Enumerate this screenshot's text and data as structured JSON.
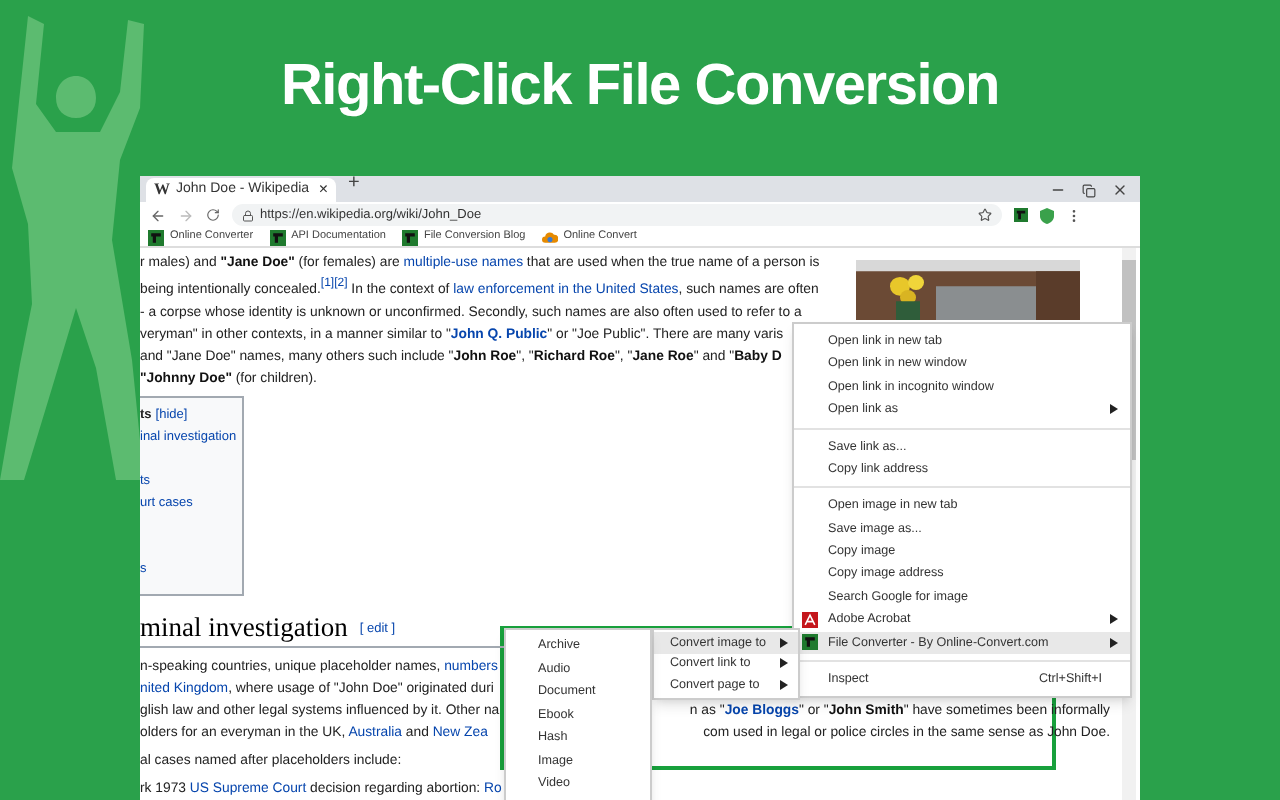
{
  "banner": {
    "title": "Right-Click File Conversion"
  },
  "browser": {
    "tab": {
      "favicon": "W",
      "title": "John Doe - Wikipedia",
      "close": "×",
      "new_tab": "+"
    },
    "url": "https://en.wikipedia.org/wiki/John_Doe",
    "bookmarks": [
      {
        "label": "Online Converter",
        "kind": "converter"
      },
      {
        "label": "API Documentation",
        "kind": "converter"
      },
      {
        "label": "File Conversion Blog",
        "kind": "converter"
      },
      {
        "label": "Online Convert",
        "kind": "cloud"
      }
    ]
  },
  "article": {
    "intro_lines": [
      [
        {
          "kind": "plain",
          "text": "r males) and "
        },
        {
          "kind": "bold",
          "text": "\"Jane Doe\""
        },
        {
          "kind": "plain",
          "text": " (for females) are "
        },
        {
          "kind": "link",
          "text": "multiple-use names"
        },
        {
          "kind": "plain",
          "text": " that are used when the true name of a person is"
        }
      ],
      [
        {
          "kind": "plain",
          "text": "being intentionally concealed."
        },
        {
          "kind": "sup",
          "text": "[1][2]"
        },
        {
          "kind": "plain",
          "text": " In the context of "
        },
        {
          "kind": "link",
          "text": "law enforcement in the United States"
        },
        {
          "kind": "plain",
          "text": ", such names are often"
        }
      ],
      [
        {
          "kind": "plain",
          "text": "- a corpse whose identity is unknown or unconfirmed. Secondly, such names are also often used to refer to a"
        }
      ],
      [
        {
          "kind": "plain",
          "text": "veryman\" in other contexts, in a manner similar to \""
        },
        {
          "kind": "boldlink",
          "text": "John Q. Public"
        },
        {
          "kind": "plain",
          "text": "\" or \"Joe Public\". There are many varis"
        }
      ],
      [
        {
          "kind": "plain",
          "text": " and \"Jane Doe\" names, many others such include \""
        },
        {
          "kind": "bold",
          "text": "John Roe"
        },
        {
          "kind": "plain",
          "text": "\", \""
        },
        {
          "kind": "bold",
          "text": "Richard Roe"
        },
        {
          "kind": "plain",
          "text": "\", \""
        },
        {
          "kind": "bold",
          "text": "Jane Roe"
        },
        {
          "kind": "plain",
          "text": "\" and \""
        },
        {
          "kind": "bold",
          "text": "Baby D"
        }
      ],
      [
        {
          "kind": "bold",
          "text": "\"Johnny Doe\""
        },
        {
          "kind": "plain",
          "text": " (for children)."
        }
      ]
    ],
    "toc": [
      {
        "kind": "head",
        "text": "ts",
        "link": "[hide]"
      },
      {
        "kind": "item",
        "text": "inal investigation"
      },
      {
        "kind": "gap"
      },
      {
        "kind": "item",
        "text": "ts"
      },
      {
        "kind": "item",
        "text": "urt cases"
      },
      {
        "kind": "gap"
      },
      {
        "kind": "gap"
      },
      {
        "kind": "item",
        "text": "s"
      }
    ],
    "heading": "minal investigation",
    "edit": "[ edit ]",
    "body_lines": [
      {
        "left": [
          {
            "kind": "plain",
            "text": "n-speaking countries, unique placeholder names, "
          },
          {
            "kind": "link",
            "text": "numbers"
          }
        ]
      },
      {
        "left": [
          {
            "kind": "link",
            "text": "nited Kingdom"
          },
          {
            "kind": "plain",
            "text": ", where usage of \"John Doe\" originated duri"
          }
        ]
      },
      {
        "left": [
          {
            "kind": "plain",
            "text": "glish law and other legal systems influenced by it. Other na"
          }
        ],
        "right": [
          {
            "kind": "plain",
            "text": "n as \""
          },
          {
            "kind": "boldlink",
            "text": "Joe Bloggs"
          },
          {
            "kind": "plain",
            "text": "\" or \""
          },
          {
            "kind": "bold",
            "text": "John Smith"
          },
          {
            "kind": "plain",
            "text": "\" have sometimes been informally"
          }
        ]
      },
      {
        "left": [
          {
            "kind": "plain",
            "text": "olders for an everyman in the UK, "
          },
          {
            "kind": "link",
            "text": "Australia"
          },
          {
            "kind": "plain",
            "text": " and "
          },
          {
            "kind": "link",
            "text": "New Zea"
          }
        ],
        "right": [
          {
            "kind": "plain",
            "text": "com used in legal or police circles in the same sense as John Doe."
          }
        ]
      },
      {
        "left": [
          {
            "kind": "plain",
            "text": "al cases named after placeholders include:"
          }
        ]
      },
      {
        "left": [
          {
            "kind": "plain",
            "text": "rk 1973 "
          },
          {
            "kind": "link",
            "text": "US Supreme Court"
          },
          {
            "kind": "plain",
            "text": " decision regarding abortion: "
          },
          {
            "kind": "link",
            "text": "Ro"
          }
        ]
      }
    ]
  },
  "context_menu": {
    "items": [
      {
        "kind": "item",
        "label": "Open link in new tab",
        "submenu": false,
        "selected": false
      },
      {
        "kind": "item",
        "label": "Open link in new window",
        "submenu": false,
        "selected": false
      },
      {
        "kind": "item",
        "label": "Open link in incognito window",
        "submenu": false,
        "selected": false
      },
      {
        "kind": "item",
        "label": "Open link as",
        "submenu": true,
        "selected": false
      },
      {
        "kind": "separator"
      },
      {
        "kind": "item",
        "label": "Save link as...",
        "submenu": false,
        "selected": false
      },
      {
        "kind": "item",
        "label": "Copy link address",
        "submenu": false,
        "selected": false
      },
      {
        "kind": "separator"
      },
      {
        "kind": "item",
        "label": "Open image in new tab",
        "submenu": false,
        "selected": false
      },
      {
        "kind": "item",
        "label": "Save image as...",
        "submenu": false,
        "selected": false
      },
      {
        "kind": "item",
        "label": "Copy image",
        "submenu": false,
        "selected": false
      },
      {
        "kind": "item",
        "label": "Copy image address",
        "submenu": false,
        "selected": false
      },
      {
        "kind": "item",
        "label": "Search Google for image",
        "submenu": false,
        "selected": false
      },
      {
        "kind": "acrobat",
        "label": "Adobe Acrobat",
        "submenu": true,
        "selected": false
      },
      {
        "kind": "converter",
        "label": "File Converter - By Online-Convert.com",
        "submenu": true,
        "selected": true
      },
      {
        "kind": "separator"
      },
      {
        "kind": "item",
        "label": "Inspect",
        "shortcut": "Ctrl+Shift+I",
        "submenu": false,
        "selected": false
      }
    ]
  },
  "convert_menu": {
    "items": [
      {
        "label": "Convert image to",
        "selected": true
      },
      {
        "label": "Convert link to",
        "selected": false
      },
      {
        "label": "Convert page to",
        "selected": false
      }
    ]
  },
  "format_menu": {
    "items": [
      {
        "label": "Archive"
      },
      {
        "label": "Audio"
      },
      {
        "label": "Document"
      },
      {
        "label": "Ebook"
      },
      {
        "label": "Hash"
      },
      {
        "label": "Image"
      },
      {
        "label": "Video"
      }
    ]
  }
}
